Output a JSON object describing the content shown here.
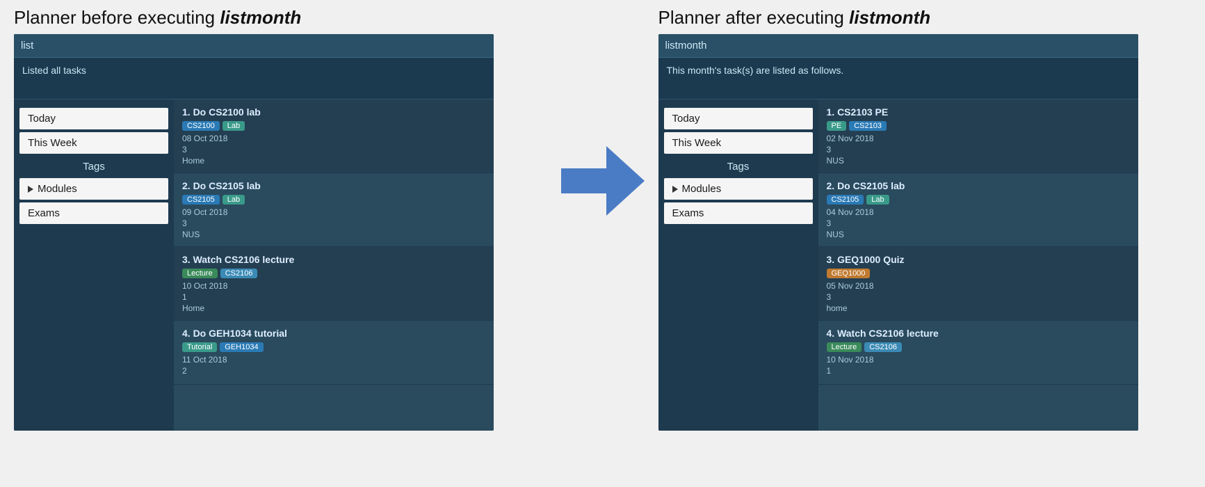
{
  "headings": {
    "before_title": "Planner before executing ",
    "before_command": "listmonth",
    "after_title": "Planner after executing ",
    "after_command": "listmonth"
  },
  "before": {
    "command": "list",
    "response": "Listed all tasks",
    "sidebar": {
      "today_label": "Today",
      "thisweek_label": "This Week",
      "tags_label": "Tags",
      "modules_label": "Modules",
      "exams_label": "Exams"
    },
    "tasks": [
      {
        "number": "1.",
        "title": "Do CS2100 lab",
        "tags": [
          {
            "label": "CS2100",
            "color": "tag-blue"
          },
          {
            "label": "Lab",
            "color": "tag-teal"
          }
        ],
        "date": "08 Oct 2018",
        "priority": "3",
        "location": "Home"
      },
      {
        "number": "2.",
        "title": "Do CS2105 lab",
        "tags": [
          {
            "label": "CS2105",
            "color": "tag-blue"
          },
          {
            "label": "Lab",
            "color": "tag-teal"
          }
        ],
        "date": "09 Oct 2018",
        "priority": "3",
        "location": "NUS"
      },
      {
        "number": "3.",
        "title": "Watch CS2106 lecture",
        "tags": [
          {
            "label": "Lecture",
            "color": "tag-green"
          },
          {
            "label": "CS2106",
            "color": "tag-lightblue"
          }
        ],
        "date": "10 Oct 2018",
        "priority": "1",
        "location": "Home"
      },
      {
        "number": "4.",
        "title": "Do GEH1034 tutorial",
        "tags": [
          {
            "label": "Tutorial",
            "color": "tag-teal"
          },
          {
            "label": "GEH1034",
            "color": "tag-blue"
          }
        ],
        "date": "11 Oct 2018",
        "priority": "2",
        "location": ""
      }
    ]
  },
  "after": {
    "command": "listmonth",
    "response": "This month's task(s) are listed as follows.",
    "sidebar": {
      "today_label": "Today",
      "thisweek_label": "This Week",
      "tags_label": "Tags",
      "modules_label": "Modules",
      "exams_label": "Exams"
    },
    "tasks": [
      {
        "number": "1.",
        "title": "CS2103 PE",
        "tags": [
          {
            "label": "PE",
            "color": "tag-teal"
          },
          {
            "label": "CS2103",
            "color": "tag-blue"
          }
        ],
        "date": "02 Nov 2018",
        "priority": "3",
        "location": "NUS"
      },
      {
        "number": "2.",
        "title": "Do CS2105 lab",
        "tags": [
          {
            "label": "CS2105",
            "color": "tag-blue"
          },
          {
            "label": "Lab",
            "color": "tag-teal"
          }
        ],
        "date": "04 Nov 2018",
        "priority": "3",
        "location": "NUS"
      },
      {
        "number": "3.",
        "title": "GEQ1000 Quiz",
        "tags": [
          {
            "label": "GEQ1000",
            "color": "tag-orange"
          }
        ],
        "date": "05 Nov 2018",
        "priority": "3",
        "location": "home"
      },
      {
        "number": "4.",
        "title": "Watch CS2106 lecture",
        "tags": [
          {
            "label": "Lecture",
            "color": "tag-green"
          },
          {
            "label": "CS2106",
            "color": "tag-lightblue"
          }
        ],
        "date": "10 Nov 2018",
        "priority": "1",
        "location": ""
      }
    ]
  }
}
